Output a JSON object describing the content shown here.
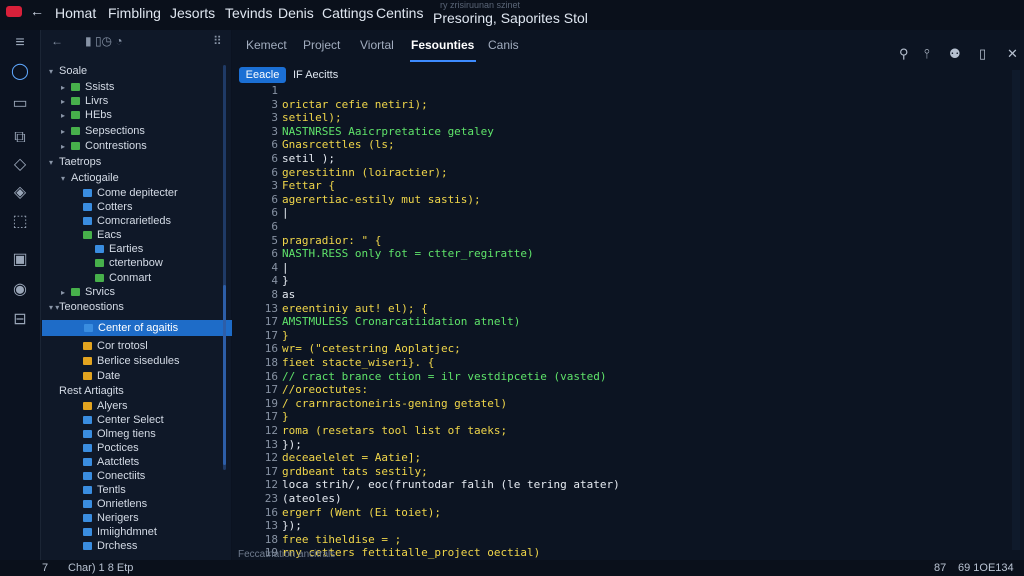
{
  "menubar": {
    "back": "←",
    "items": [
      "Homat",
      "Fimbling",
      "Jesorts",
      "Tevinds",
      "Denis",
      "Cattings",
      "Centins"
    ],
    "title": "Presoring,  Saporites Stol",
    "faded": "ry zrisiruunan szinet"
  },
  "activity": [
    "≡",
    "◯",
    "▭",
    "⧉",
    "◇",
    "◈",
    "⬚",
    "▣",
    "◉",
    "⊟"
  ],
  "sidebar": {
    "toolbar": {
      "back": "←",
      "icons": "▮ ▯◷   ◔",
      "more": "⠿"
    },
    "items": [
      {
        "label": "Soale",
        "depth": 0,
        "twisty": "▾",
        "icon": "none"
      },
      {
        "label": "Ssists",
        "depth": 1,
        "twisty": "▸",
        "icon": "f-green"
      },
      {
        "label": "Livrs",
        "depth": 1,
        "twisty": "▸",
        "icon": "f-green"
      },
      {
        "label": "HEbs",
        "depth": 1,
        "twisty": "▸",
        "icon": "f-green"
      },
      {
        "label": "Sepsections",
        "depth": 1,
        "twisty": "▸",
        "icon": "f-green"
      },
      {
        "label": "Contrestions",
        "depth": 1,
        "twisty": "▸",
        "icon": "f-green"
      },
      {
        "label": "Taetrops",
        "depth": 0,
        "twisty": "▾",
        "icon": "none"
      },
      {
        "label": "Actiogaile",
        "depth": 1,
        "twisty": "▾",
        "icon": "none"
      },
      {
        "label": "Come depitecter",
        "depth": 2,
        "twisty": "",
        "icon": "f-blue"
      },
      {
        "label": "Cotters",
        "depth": 2,
        "twisty": "",
        "icon": "f-blue"
      },
      {
        "label": "Comcrarietleds",
        "depth": 2,
        "twisty": "",
        "icon": "f-blue"
      },
      {
        "label": "Eacs",
        "depth": 2,
        "twisty": "",
        "icon": "f-green"
      },
      {
        "label": "Earties",
        "depth": 3,
        "twisty": "",
        "icon": "f-blue"
      },
      {
        "label": "ctertenbow",
        "depth": 3,
        "twisty": "",
        "icon": "f-green"
      },
      {
        "label": "Conmart",
        "depth": 3,
        "twisty": "",
        "icon": "f-green"
      },
      {
        "label": "Srvics",
        "depth": 1,
        "twisty": "▸",
        "icon": "f-green"
      },
      {
        "label": "Teoneostions",
        "depth": 0,
        "twisty": "▾ ▾",
        "icon": "none"
      },
      {
        "label": "Center of agaitis",
        "depth": 2,
        "twisty": "",
        "icon": "f-blue",
        "selected": true
      },
      {
        "label": "Cor trotosl",
        "depth": 2,
        "twisty": "",
        "icon": "f-gold"
      },
      {
        "label": "Berlice sisedules",
        "depth": 2,
        "twisty": "",
        "icon": "f-gold"
      },
      {
        "label": "Date",
        "depth": 2,
        "twisty": "",
        "icon": "f-gold"
      },
      {
        "label": "Rest Artiagits",
        "depth": 0,
        "twisty": "",
        "icon": "none"
      },
      {
        "label": "Alyers",
        "depth": 2,
        "twisty": "",
        "icon": "f-gold"
      },
      {
        "label": "Center Select",
        "depth": 2,
        "twisty": "",
        "icon": "f-blue"
      },
      {
        "label": "Olmeg tiens",
        "depth": 2,
        "twisty": "",
        "icon": "f-blue"
      },
      {
        "label": "Poctices",
        "depth": 2,
        "twisty": "",
        "icon": "f-blue"
      },
      {
        "label": "Aatctlets",
        "depth": 2,
        "twisty": "",
        "icon": "f-blue"
      },
      {
        "label": "Conectiits",
        "depth": 2,
        "twisty": "",
        "icon": "f-blue"
      },
      {
        "label": "Tentls",
        "depth": 2,
        "twisty": "",
        "icon": "f-blue"
      },
      {
        "label": "Onrietlens",
        "depth": 2,
        "twisty": "",
        "icon": "f-blue"
      },
      {
        "label": "Nerigers",
        "depth": 2,
        "twisty": "",
        "icon": "f-blue"
      },
      {
        "label": "Imiighdmnet",
        "depth": 2,
        "twisty": "",
        "icon": "f-blue"
      },
      {
        "label": "Drchess",
        "depth": 2,
        "twisty": "",
        "icon": "f-blue"
      }
    ]
  },
  "tabs": [
    "Kemect",
    "Project",
    "Viortal",
    "Fesounties",
    "Canis"
  ],
  "active_tab": "Fesounties",
  "top_icons": [
    "⚲",
    "⫯",
    "⚉",
    "▯",
    "✕"
  ],
  "breadcrumb": {
    "badge": "Eeacle",
    "label": "IF Aecitts"
  },
  "code": [
    {
      "n": "1",
      "g": "",
      "t": "",
      "c": "c-white"
    },
    {
      "n": "3",
      "g": "",
      "t": "orictar cefie netiri);",
      "c": "c-yellow"
    },
    {
      "n": "3",
      "g": "",
      "t": "setilel);",
      "c": "c-yellow"
    },
    {
      "n": "3",
      "g": "",
      "t": "NASTNRSES Aaicrpretatice getaley",
      "c": "c-green"
    },
    {
      "n": "6",
      "g": "",
      "t": "Gnasrcettles (ls;",
      "c": "c-yellow"
    },
    {
      "n": "6",
      "g": "",
      "t": "setil );",
      "c": "c-white"
    },
    {
      "n": "6",
      "g": "",
      "t": "gerestitinn (loiractier);",
      "c": "c-yellow"
    },
    {
      "n": "3",
      "g": "",
      "t": "  Fettar {",
      "c": "c-yellow"
    },
    {
      "n": "6",
      "g": "",
      "t": "     agerertiac-estily mut sastis);",
      "c": "c-yellow"
    },
    {
      "n": "6",
      "g": "",
      "t": "     |",
      "c": "c-white"
    },
    {
      "n": "6",
      "g": "",
      "t": "",
      "c": "c-white"
    },
    {
      "n": "5",
      "g": "",
      "t": "     pragradior: \" {",
      "c": "c-yellow"
    },
    {
      "n": "6",
      "g": "",
      "t": "     NASTH.RESS only fot = ctter_regiratte)",
      "c": "c-green"
    },
    {
      "n": "4",
      "g": "",
      "t": "     |",
      "c": "c-white"
    },
    {
      "n": "4",
      "g": "",
      "t": "  }",
      "c": "c-white"
    },
    {
      "n": "8",
      "g": "",
      "t": "     as",
      "c": "c-white"
    },
    {
      "n": "13",
      "g": "",
      "t": "ereentiniy aut! el); {",
      "c": "c-yellow"
    },
    {
      "n": "17",
      "g": "",
      "t": "    AMSTMULESS Cronarcatiidation atnelt)",
      "c": "c-green"
    },
    {
      "n": "17",
      "g": "",
      "t": "    }",
      "c": "c-yellow"
    },
    {
      "n": "16",
      "g": "",
      "t": "    wr= (\"cetestring Aoplatjec;",
      "c": "c-yellow"
    },
    {
      "n": "18",
      "g": "",
      "t": "    fieet stacte_wiseri}. {",
      "c": "c-yellow"
    },
    {
      "n": "16",
      "g": "",
      "t": "    //   cract brance ction = ilr vestdipcetie (vasted)",
      "c": "c-green"
    },
    {
      "n": "17",
      "g": "",
      "t": "    //oreoctutes:",
      "c": "c-yellow"
    },
    {
      "n": "19",
      "g": "",
      "t": "    /    crarnractoneiris-gening getatel)",
      "c": "c-yellow"
    },
    {
      "n": "17",
      "g": "",
      "t": "    }",
      "c": "c-yellow"
    },
    {
      "n": "12",
      "g": "",
      "t": "    roma (resetars tool list of taeks;",
      "c": "c-yellow"
    },
    {
      "n": "13",
      "g": "",
      "t": "});",
      "c": "c-white"
    },
    {
      "n": "12",
      "g": "",
      "t": "deceaelelet = Aatie];",
      "c": "c-yellow"
    },
    {
      "n": "17",
      "g": "",
      "t": "  grdbeant tats sestily;",
      "c": "c-yellow"
    },
    {
      "n": "12",
      "g": "",
      "t": "     loca strih/, eoc(fruntodar falih (le tering atater)",
      "c": "c-white"
    },
    {
      "n": "23",
      "g": "",
      "t": "     (ateoles)",
      "c": "c-white"
    },
    {
      "n": "16",
      "g": "",
      "t": "     ergerf (Went (Ei toiet);",
      "c": "c-yellow"
    },
    {
      "n": "13",
      "g": "",
      "t": "});",
      "c": "c-white"
    },
    {
      "n": "18",
      "g": "",
      "t": "free tiheldise = ;",
      "c": "c-yellow"
    },
    {
      "n": "19",
      "g": "",
      "t": "rny cetters fettitalle_project oectial)",
      "c": "c-yellow"
    }
  ],
  "panel_footer": "Feccatnation ancitrals",
  "status": {
    "left": "Char)   1 8 Etp",
    "left_num": "7",
    "right": "69 1OE134",
    "right_sub": "87"
  }
}
